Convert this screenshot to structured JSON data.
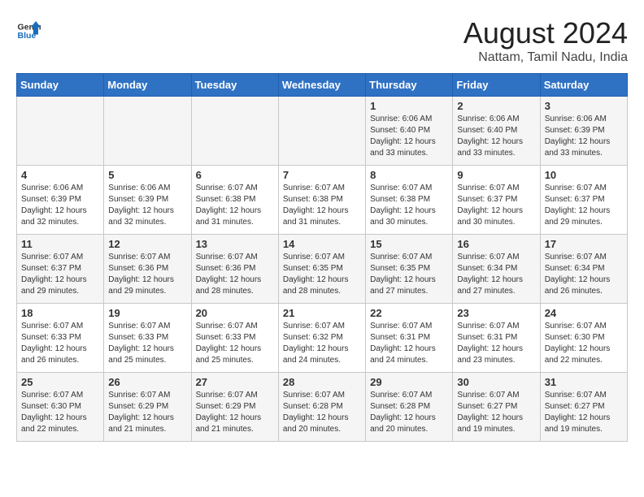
{
  "header": {
    "logo_line1": "General",
    "logo_line2": "Blue",
    "month_year": "August 2024",
    "location": "Nattam, Tamil Nadu, India"
  },
  "weekdays": [
    "Sunday",
    "Monday",
    "Tuesday",
    "Wednesday",
    "Thursday",
    "Friday",
    "Saturday"
  ],
  "weeks": [
    [
      {
        "day": "",
        "info": ""
      },
      {
        "day": "",
        "info": ""
      },
      {
        "day": "",
        "info": ""
      },
      {
        "day": "",
        "info": ""
      },
      {
        "day": "1",
        "info": "Sunrise: 6:06 AM\nSunset: 6:40 PM\nDaylight: 12 hours\nand 33 minutes."
      },
      {
        "day": "2",
        "info": "Sunrise: 6:06 AM\nSunset: 6:40 PM\nDaylight: 12 hours\nand 33 minutes."
      },
      {
        "day": "3",
        "info": "Sunrise: 6:06 AM\nSunset: 6:39 PM\nDaylight: 12 hours\nand 33 minutes."
      }
    ],
    [
      {
        "day": "4",
        "info": "Sunrise: 6:06 AM\nSunset: 6:39 PM\nDaylight: 12 hours\nand 32 minutes."
      },
      {
        "day": "5",
        "info": "Sunrise: 6:06 AM\nSunset: 6:39 PM\nDaylight: 12 hours\nand 32 minutes."
      },
      {
        "day": "6",
        "info": "Sunrise: 6:07 AM\nSunset: 6:38 PM\nDaylight: 12 hours\nand 31 minutes."
      },
      {
        "day": "7",
        "info": "Sunrise: 6:07 AM\nSunset: 6:38 PM\nDaylight: 12 hours\nand 31 minutes."
      },
      {
        "day": "8",
        "info": "Sunrise: 6:07 AM\nSunset: 6:38 PM\nDaylight: 12 hours\nand 30 minutes."
      },
      {
        "day": "9",
        "info": "Sunrise: 6:07 AM\nSunset: 6:37 PM\nDaylight: 12 hours\nand 30 minutes."
      },
      {
        "day": "10",
        "info": "Sunrise: 6:07 AM\nSunset: 6:37 PM\nDaylight: 12 hours\nand 29 minutes."
      }
    ],
    [
      {
        "day": "11",
        "info": "Sunrise: 6:07 AM\nSunset: 6:37 PM\nDaylight: 12 hours\nand 29 minutes."
      },
      {
        "day": "12",
        "info": "Sunrise: 6:07 AM\nSunset: 6:36 PM\nDaylight: 12 hours\nand 29 minutes."
      },
      {
        "day": "13",
        "info": "Sunrise: 6:07 AM\nSunset: 6:36 PM\nDaylight: 12 hours\nand 28 minutes."
      },
      {
        "day": "14",
        "info": "Sunrise: 6:07 AM\nSunset: 6:35 PM\nDaylight: 12 hours\nand 28 minutes."
      },
      {
        "day": "15",
        "info": "Sunrise: 6:07 AM\nSunset: 6:35 PM\nDaylight: 12 hours\nand 27 minutes."
      },
      {
        "day": "16",
        "info": "Sunrise: 6:07 AM\nSunset: 6:34 PM\nDaylight: 12 hours\nand 27 minutes."
      },
      {
        "day": "17",
        "info": "Sunrise: 6:07 AM\nSunset: 6:34 PM\nDaylight: 12 hours\nand 26 minutes."
      }
    ],
    [
      {
        "day": "18",
        "info": "Sunrise: 6:07 AM\nSunset: 6:33 PM\nDaylight: 12 hours\nand 26 minutes."
      },
      {
        "day": "19",
        "info": "Sunrise: 6:07 AM\nSunset: 6:33 PM\nDaylight: 12 hours\nand 25 minutes."
      },
      {
        "day": "20",
        "info": "Sunrise: 6:07 AM\nSunset: 6:33 PM\nDaylight: 12 hours\nand 25 minutes."
      },
      {
        "day": "21",
        "info": "Sunrise: 6:07 AM\nSunset: 6:32 PM\nDaylight: 12 hours\nand 24 minutes."
      },
      {
        "day": "22",
        "info": "Sunrise: 6:07 AM\nSunset: 6:31 PM\nDaylight: 12 hours\nand 24 minutes."
      },
      {
        "day": "23",
        "info": "Sunrise: 6:07 AM\nSunset: 6:31 PM\nDaylight: 12 hours\nand 23 minutes."
      },
      {
        "day": "24",
        "info": "Sunrise: 6:07 AM\nSunset: 6:30 PM\nDaylight: 12 hours\nand 22 minutes."
      }
    ],
    [
      {
        "day": "25",
        "info": "Sunrise: 6:07 AM\nSunset: 6:30 PM\nDaylight: 12 hours\nand 22 minutes."
      },
      {
        "day": "26",
        "info": "Sunrise: 6:07 AM\nSunset: 6:29 PM\nDaylight: 12 hours\nand 21 minutes."
      },
      {
        "day": "27",
        "info": "Sunrise: 6:07 AM\nSunset: 6:29 PM\nDaylight: 12 hours\nand 21 minutes."
      },
      {
        "day": "28",
        "info": "Sunrise: 6:07 AM\nSunset: 6:28 PM\nDaylight: 12 hours\nand 20 minutes."
      },
      {
        "day": "29",
        "info": "Sunrise: 6:07 AM\nSunset: 6:28 PM\nDaylight: 12 hours\nand 20 minutes."
      },
      {
        "day": "30",
        "info": "Sunrise: 6:07 AM\nSunset: 6:27 PM\nDaylight: 12 hours\nand 19 minutes."
      },
      {
        "day": "31",
        "info": "Sunrise: 6:07 AM\nSunset: 6:27 PM\nDaylight: 12 hours\nand 19 minutes."
      }
    ]
  ]
}
